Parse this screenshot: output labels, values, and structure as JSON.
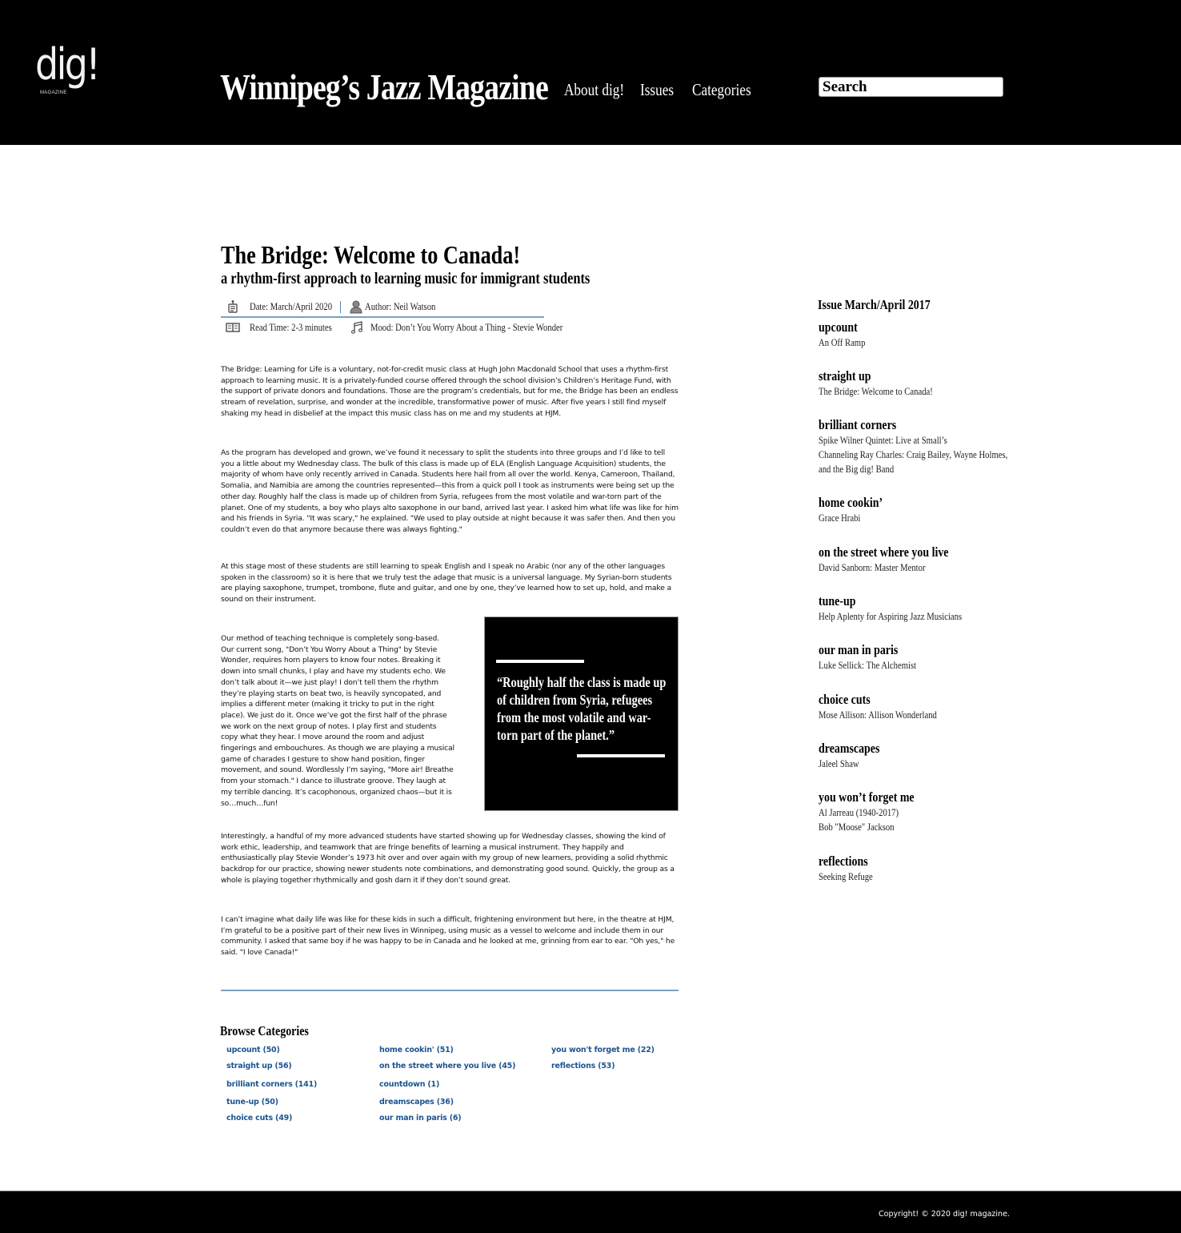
{
  "header": {
    "logo_text": "dig!",
    "logo_subtext": "MAGAZINE",
    "site_title": "Winnipeg’s Jazz Magazine",
    "nav": [
      "About dig!",
      "Issues",
      "Categories"
    ],
    "search_placeholder": "Search"
  },
  "article": {
    "title": "The Bridge: Welcome to Canada!",
    "subtitle": "a rhythm-first approach to learning music for immigrant students",
    "meta": {
      "date": "Date: March/April 2020",
      "author": "Author: Neil Watson",
      "read_time": "Read Time: 2-3 minutes",
      "mood": "Mood: Don’t You Worry About a Thing - Stevie Wonder"
    },
    "paragraphs": [
      "The Bridge: Learning for Life is a voluntary, not-for-credit music class at Hugh John Macdonald School that uses a rhythm-first approach to learning music. It is a privately-funded course offered through the school division’s Children’s Heritage Fund, with the support of private donors and foundations. Those are the program’s credentials, but for me, the Bridge has been an endless stream of revelation, surprise, and wonder at the incredible, transformative power of music. After five years I still find myself shaking my head in disbelief at the impact this music class has on me and my students at HJM.",
      "As the program has developed and grown, we’ve found it necessary to split the students into three groups and I’d like to tell you a little about my Wednesday class. The bulk of this class is made up of ELA (English Language Acquisition) students, the majority of whom have only recently arrived in Canada. Students here hail from all over the world. Kenya, Cameroon, Thailand, Somalia, and Namibia are among the countries represented—this from a quick poll I took as instruments were being set up the other day. Roughly half the class is made up of children from Syria, refugees from the most volatile and war-torn part of the planet. One of my students, a boy who plays alto saxophone in our band, arrived last year. I asked him what life was like for him and his friends in Syria. \"It was scary,\" he explained. \"We used to play outside at night because it was safer then. And then you couldn’t even do that anymore because there was always fighting.\"",
      "At this stage most of these students are still learning to speak English and I speak no Arabic (nor any of the other languages spoken in the classroom) so it is here that we truly test the adage that music is a universal language. My Syrian-born students are playing saxophone, trumpet, trombone, flute and guitar, and one by one, they’ve learned how to set up, hold, and make a sound on their instrument.",
      "Our method of teaching technique is completely song-based. Our current song, \"Don’t You Worry About a Thing\" by Stevie Wonder, requires horn players to know four notes. Breaking it down into small chunks, I play and have my students echo. We don’t talk about it—we just play! I don’t tell them the rhythm they’re playing starts on beat two, is heavily syncopated, and implies a different meter (making it tricky to put in the right place). We just do it. Once we’ve got the first half of the phrase we work on the next group of notes. I play first and students copy what they hear. I move around the room and adjust fingerings and embouchures. As though we are playing a musical game of charades I gesture to show hand position, finger movement, and sound. Wordlessly I’m saying, \"More air! Breathe from your stomach.\" I dance to illustrate groove. They laugh at my terrible dancing. It’s cacophonous, organized chaos—but it is so…much…fun!",
      "Interestingly, a handful of my more advanced students have started showing up for Wednesday classes, showing the kind of work ethic, leadership, and teamwork that are fringe benefits of learning a musical instrument. They happily and enthusiastically play Stevie Wonder’s 1973 hit over and over again with my group of new learners, providing a solid rhythmic backdrop for our practice, showing newer students note combinations, and demonstrating good sound. Quickly, the group as a whole is playing together rhythmically and gosh darn it if they don’t sound great.",
      "I can’t imagine what daily life was like for these kids in such a difficult, frightening environment but here, in the theatre at HJM, I’m grateful to be a positive part of their new lives in Winnipeg, using music as a vessel to welcome and include them in our community. I asked that same boy if he was happy to be in Canada and he looked at me, grinning from ear to ear. \"Oh yes,\" he said. \"I love Canada!\""
    ],
    "pull_quote": "“Roughly half the class is made up of children from Syria, refugees from the most volatile and war-torn part of the planet.”"
  },
  "browse": {
    "title": "Browse Categories",
    "columns": [
      [
        "upcount (50)",
        "straight up (56)",
        "brilliant corners (141)",
        "tune-up (50)",
        "choice cuts (49)"
      ],
      [
        "home cookin' (51)",
        "on the street where you live (45)",
        "countdown (1)",
        "dreamscapes (36)",
        "our man in paris (6)"
      ],
      [
        "you won't forget me (22)",
        "reflections (53)"
      ]
    ]
  },
  "sidebar": {
    "issue_title": "Issue March/April 2017",
    "sections": [
      {
        "heading": "upcount",
        "items": [
          "An Off Ramp"
        ]
      },
      {
        "heading": "straight up",
        "items": [
          "The Bridge: Welcome to Canada!"
        ]
      },
      {
        "heading": "brilliant corners",
        "items": [
          "Spike Wilner Quintet: Live at Small’s",
          "Channeling Ray Charles: Craig Bailey, Wayne Holmes,",
          "and the Big dig! Band"
        ]
      },
      {
        "heading": "home cookin’",
        "items": [
          "Grace Hrabi"
        ]
      },
      {
        "heading": "on the street where you live",
        "items": [
          "David Sanborn: Master Mentor"
        ]
      },
      {
        "heading": "tune-up",
        "items": [
          "Help Aplenty for Aspiring Jazz Musicians"
        ]
      },
      {
        "heading": "our man in paris",
        "items": [
          "Luke Sellick: The Alchemist"
        ]
      },
      {
        "heading": "choice cuts",
        "items": [
          "Mose Allison: Allison Wonderland"
        ]
      },
      {
        "heading": "dreamscapes",
        "items": [
          "Jaleel Shaw"
        ]
      },
      {
        "heading": "you won’t forget me",
        "items": [
          "Al Jarreau (1940-2017)",
          "Bob \"Moose\" Jackson"
        ]
      },
      {
        "heading": "reflections",
        "items": [
          "Seeking Refuge"
        ]
      }
    ]
  },
  "footer": {
    "copyright": "Copyright! © 2020 dig! magazine."
  },
  "colors": {
    "header_bg": "#000000",
    "link_blue": "#1c5590",
    "divider_blue": "#7b9fc4"
  }
}
